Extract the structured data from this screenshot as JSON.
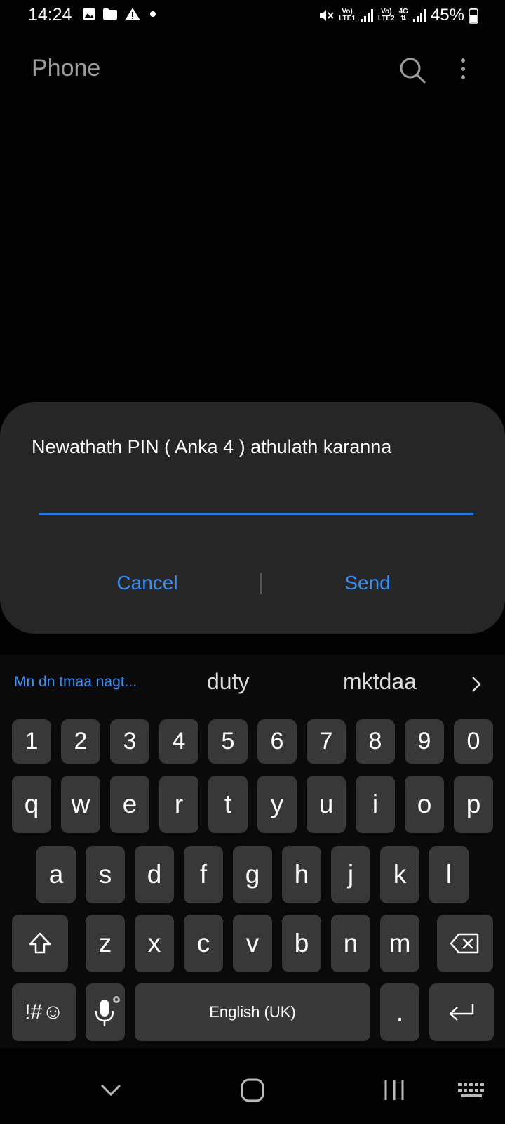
{
  "status_bar": {
    "time": "14:24",
    "sim1_label_top": "Vo)",
    "sim1_label_bottom": "LTE1",
    "sim2_label_top": "Vo)",
    "sim2_label_bottom": "LTE2",
    "network": "4G",
    "battery": "45%"
  },
  "header": {
    "title": "Phone"
  },
  "dialog": {
    "message": "Newathath PIN ( Anka 4 ) athulath karanna",
    "input_value": "",
    "cancel_label": "Cancel",
    "send_label": "Send"
  },
  "keyboard": {
    "suggestions": [
      "Mn dn tmaa nagt...",
      "duty",
      "mktdaa"
    ],
    "number_row": [
      "1",
      "2",
      "3",
      "4",
      "5",
      "6",
      "7",
      "8",
      "9",
      "0"
    ],
    "row1": [
      "q",
      "w",
      "e",
      "r",
      "t",
      "y",
      "u",
      "i",
      "o",
      "p"
    ],
    "row2": [
      "a",
      "s",
      "d",
      "f",
      "g",
      "h",
      "j",
      "k",
      "l"
    ],
    "row3": [
      "z",
      "x",
      "c",
      "v",
      "b",
      "n",
      "m"
    ],
    "symbols_label": "!#☺",
    "space_label": "English (UK)",
    "period_label": "."
  },
  "colors": {
    "accent": "#3a8ff5",
    "input_underline": "#1f7ae0",
    "dialog_bg": "#262626",
    "key_bg": "#383838"
  }
}
